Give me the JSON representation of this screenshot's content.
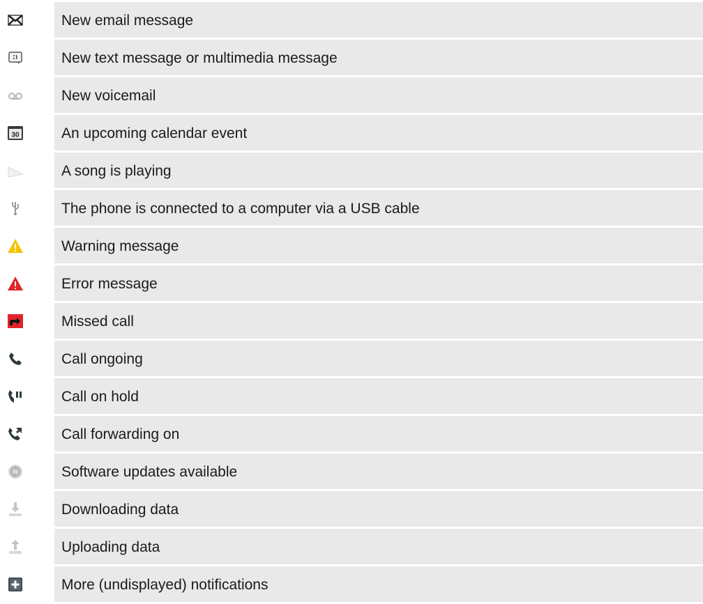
{
  "notifications": [
    {
      "icon": "email-icon",
      "label": "New email message"
    },
    {
      "icon": "text-message-icon",
      "label": "New text message or multimedia message"
    },
    {
      "icon": "voicemail-icon",
      "label": "New voicemail"
    },
    {
      "icon": "calendar-icon",
      "label": "An upcoming calendar event",
      "icon_text": "30"
    },
    {
      "icon": "play-icon",
      "label": "A song is playing"
    },
    {
      "icon": "usb-icon",
      "label": "The phone is connected to a computer via a USB cable"
    },
    {
      "icon": "warning-icon",
      "label": "Warning message"
    },
    {
      "icon": "error-icon",
      "label": "Error message"
    },
    {
      "icon": "missed-call-icon",
      "label": "Missed call"
    },
    {
      "icon": "call-ongoing-icon",
      "label": "Call ongoing"
    },
    {
      "icon": "call-on-hold-icon",
      "label": "Call on hold"
    },
    {
      "icon": "call-forwarding-icon",
      "label": "Call forwarding on"
    },
    {
      "icon": "software-update-icon",
      "label": "Software updates available"
    },
    {
      "icon": "download-icon",
      "label": "Downloading data"
    },
    {
      "icon": "upload-icon",
      "label": "Uploading data"
    },
    {
      "icon": "more-notifications-icon",
      "label": "More (undisplayed) notifications"
    }
  ],
  "colors": {
    "row_background": "#e9e9ea",
    "text": "#1a1a1a",
    "warning": "#f5c400",
    "error": "#e0242a",
    "missed_call": "#e0242a"
  }
}
